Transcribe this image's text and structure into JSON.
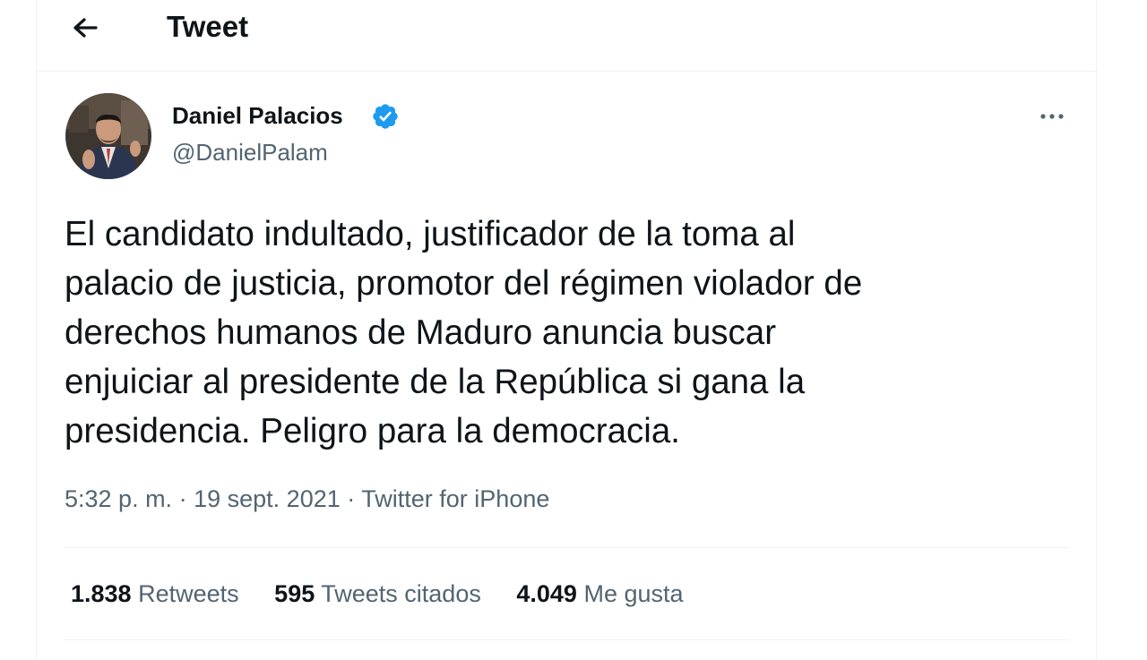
{
  "header": {
    "title": "Tweet",
    "back_icon": "arrow-left-icon"
  },
  "author": {
    "name": "Daniel Palacios",
    "handle": "@DanielPalam",
    "verified": true,
    "verified_color": "#1d9bf0"
  },
  "tweet": {
    "lines": [
      "El candidato indultado, justificador de la toma al",
      "palacio de justicia, promotor del régimen violador de",
      "derechos humanos de Maduro anuncia buscar",
      "enjuiciar al presidente de la República si gana la",
      "presidencia. Peligro para la democracia."
    ],
    "time": "5:32 p. m.",
    "date": "19 sept. 2021",
    "source": "Twitter for iPhone",
    "separator": "·"
  },
  "stats": {
    "retweets_count": "1.838",
    "retweets_label": "Retweets",
    "quotes_count": "595",
    "quotes_label": "Tweets citados",
    "likes_count": "4.049",
    "likes_label": "Me gusta"
  },
  "colors": {
    "text_primary": "#0f1419",
    "text_secondary": "#536471",
    "border": "#eff3f4",
    "accent": "#1d9bf0"
  }
}
